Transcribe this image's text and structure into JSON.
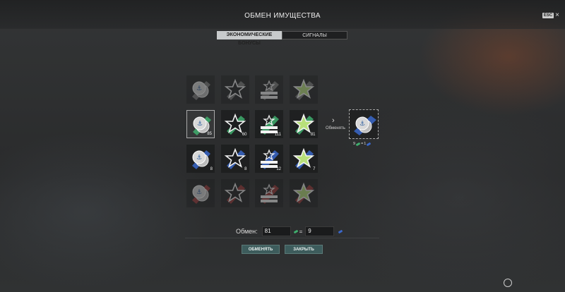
{
  "window": {
    "title": "ОБМЕН ИМУЩЕСТВА",
    "esc_label": "ESC"
  },
  "tabs": [
    {
      "label": "ЭКОНОМИЧЕСКИЕ БОНУСЫ",
      "active": true
    },
    {
      "label": "СИГНАЛЫ",
      "active": false
    }
  ],
  "grid": {
    "rows": [
      {
        "tier": "disabled-gray",
        "items": [
          {
            "type": "coin",
            "count": ""
          },
          {
            "type": "star",
            "count": ""
          },
          {
            "type": "stripes",
            "count": ""
          },
          {
            "type": "star-bright",
            "count": ""
          }
        ]
      },
      {
        "tier": "green",
        "items": [
          {
            "type": "coin",
            "count": "85"
          },
          {
            "type": "star",
            "count": "60"
          },
          {
            "type": "stripes",
            "count": "111"
          },
          {
            "type": "star-bright",
            "count": "81"
          }
        ]
      },
      {
        "tier": "blue",
        "items": [
          {
            "type": "coin",
            "count": "8"
          },
          {
            "type": "star",
            "count": "8"
          },
          {
            "type": "stripes",
            "count": "12"
          },
          {
            "type": "star-bright",
            "count": "7"
          }
        ]
      },
      {
        "tier": "disabled-red",
        "items": [
          {
            "type": "coin",
            "count": ""
          },
          {
            "type": "star",
            "count": ""
          },
          {
            "type": "stripes",
            "count": ""
          },
          {
            "type": "star-bright",
            "count": ""
          }
        ]
      }
    ]
  },
  "exchange": {
    "arrow_label": "Обменять",
    "ratio_left": "9",
    "ratio_eq": "=",
    "ratio_right": "1",
    "label": "Обмен:",
    "give_value": "81",
    "get_value": "9",
    "eq": "="
  },
  "buttons": {
    "exchange": "ОБМЕНЯТЬ",
    "close": "ЗАКРЫТЬ"
  },
  "colors": {
    "green": "#3fae6d",
    "blue": "#3a67c9",
    "red": "#b23a3a",
    "gray": "#8a8a8a",
    "accent": "#3d5c5c"
  }
}
